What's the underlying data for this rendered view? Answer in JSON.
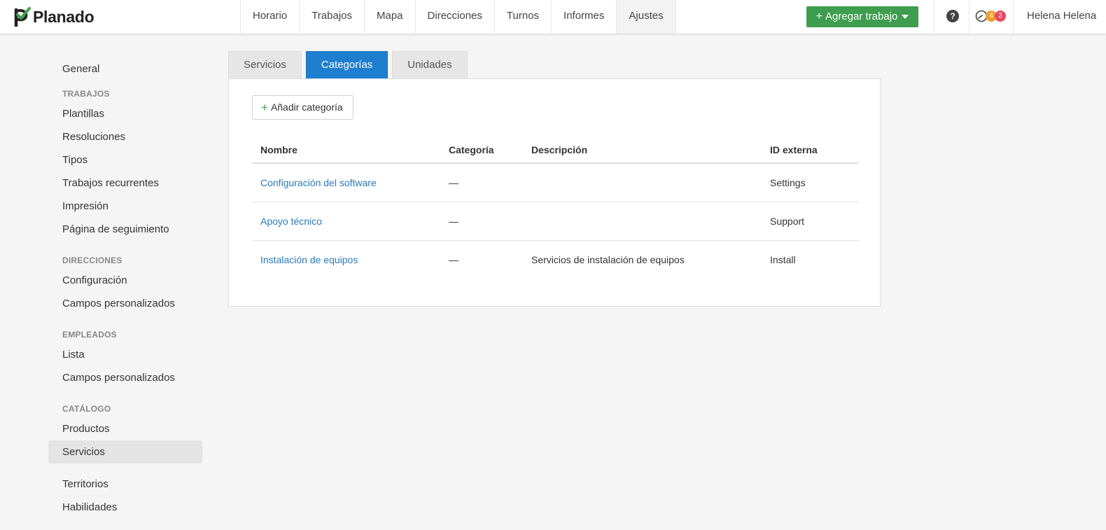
{
  "app": {
    "logo_text": "Planado"
  },
  "nav": {
    "items": [
      {
        "label": "Horario"
      },
      {
        "label": "Trabajos"
      },
      {
        "label": "Mapa"
      },
      {
        "label": "Direcciones"
      },
      {
        "label": "Turnos"
      },
      {
        "label": "Informes"
      },
      {
        "label": "Ajustes"
      }
    ],
    "active": "Ajustes"
  },
  "header": {
    "add_job_label": "Agregar trabajo",
    "help_label": "?",
    "notifications": {
      "orange_count": "4",
      "red_count": "2"
    },
    "user_name": "Helena Helena"
  },
  "sidebar": {
    "general": "General",
    "trabajos": {
      "heading": "TRABAJOS",
      "items": [
        "Plantillas",
        "Resoluciones",
        "Tipos",
        "Trabajos recurrentes",
        "Impresión",
        "Página de seguimiento"
      ]
    },
    "direcciones": {
      "heading": "DIRECCIONES",
      "items": [
        "Configuración",
        "Campos personalizados"
      ]
    },
    "empleados": {
      "heading": "EMPLEADOS",
      "items": [
        "Lista",
        "Campos personalizados"
      ]
    },
    "catalogo": {
      "heading": "CATÁLOGO",
      "items": [
        "Productos",
        "Servicios"
      ]
    },
    "extra": [
      "Territorios",
      "Habilidades"
    ],
    "active": "Servicios"
  },
  "tabs": {
    "items": [
      "Servicios",
      "Categorías",
      "Unidades"
    ],
    "active": "Categorías"
  },
  "panel": {
    "add_button": "Añadir categoría",
    "columns": [
      "Nombre",
      "Categoría",
      "Descripción",
      "ID externa"
    ],
    "rows": [
      {
        "name": "Configuración del software",
        "category": "—",
        "description": "",
        "external_id": "Settings"
      },
      {
        "name": "Apoyo técnico",
        "category": "—",
        "description": "",
        "external_id": "Support"
      },
      {
        "name": "Instalación de equipos",
        "category": "—",
        "description": "Servicios de instalación de equipos",
        "external_id": "Install"
      }
    ]
  },
  "colors": {
    "accent_blue": "#1e7fd0",
    "green_button": "#3e9d4f",
    "link_blue": "#2a7ab8",
    "badge_orange": "#f0a030",
    "badge_red": "#e84a5f"
  }
}
